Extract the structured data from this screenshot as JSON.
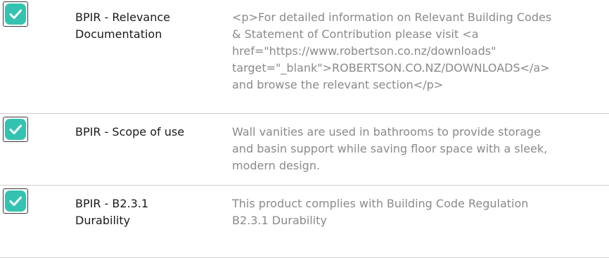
{
  "rows": [
    {
      "status_icon": "checkmark-icon",
      "label_lines": [
        "BPIR - Relevance",
        "Documentation"
      ],
      "description_lines": [
        "<p>For detailed information on Relevant Building Codes",
        "& Statement of Contribution please visit <a",
        "href=\"https://www.robertson.co.nz/downloads\"",
        "target=\"_blank\">ROBERTSON.CO.NZ/DOWNLOADS</a>",
        "and browse the relevant section</p>"
      ]
    },
    {
      "status_icon": "checkmark-icon",
      "label_lines": [
        "BPIR - Scope of use"
      ],
      "description_lines": [
        "Wall vanities are used in bathrooms to provide storage",
        "and basin support while saving floor space with a sleek,",
        "modern design."
      ]
    },
    {
      "status_icon": "checkmark-icon",
      "label_lines": [
        "BPIR - B2.3.1",
        "Durability"
      ],
      "description_lines": [
        "This product complies with Building Code Regulation",
        "B2.3.1 Durability"
      ]
    }
  ],
  "colors": {
    "check_fill": "#34c3b1",
    "check_mark": "#ffffff",
    "divider": "#cfcfcf",
    "label_text": "#1a1a1a",
    "description_text": "#8a8a8a"
  }
}
